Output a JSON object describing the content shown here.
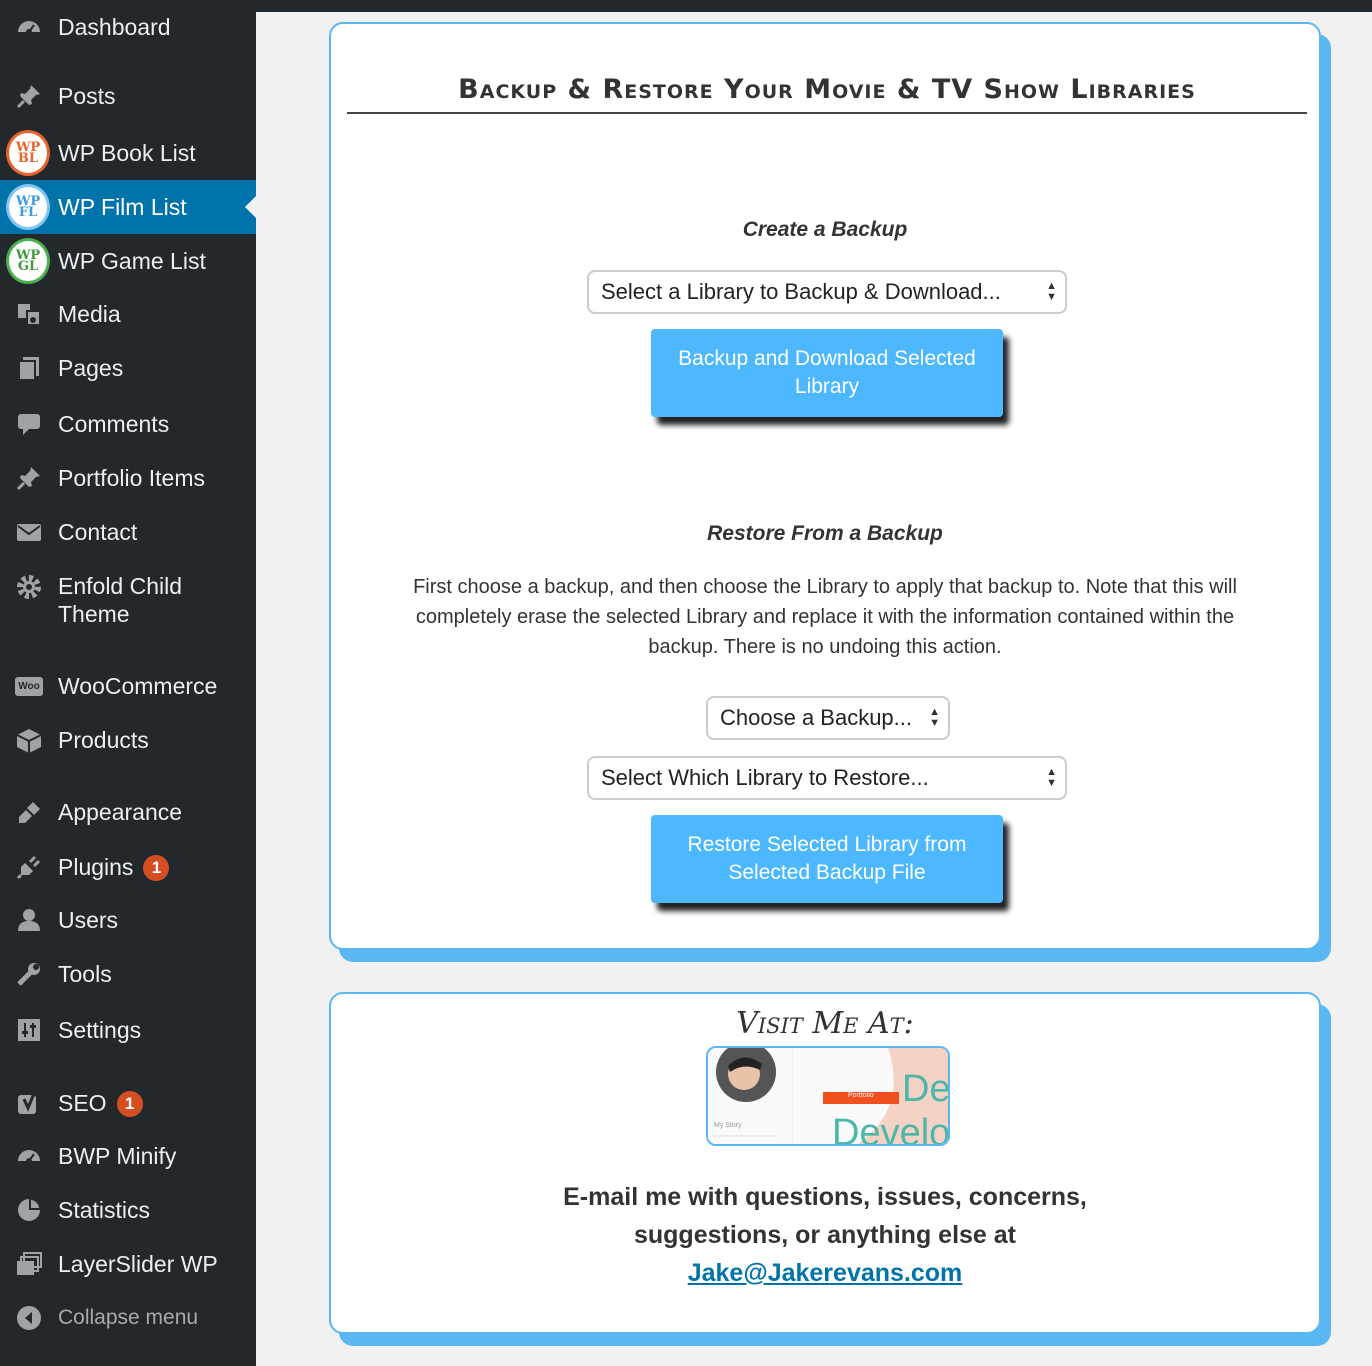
{
  "sidebar": {
    "items": [
      {
        "label": "Dashboard",
        "icon": "dashboard-icon"
      },
      {
        "label": "Posts",
        "icon": "pin-icon"
      },
      {
        "label": "WP Book List",
        "icon": "wpbl-logo-icon",
        "logo_top": "WP",
        "logo_bottom": "BL"
      },
      {
        "label": "WP Film List",
        "icon": "wpfl-logo-icon",
        "logo_top": "WP",
        "logo_bottom": "FL"
      },
      {
        "label": "WP Game List",
        "icon": "wpgl-logo-icon",
        "logo_top": "WP",
        "logo_bottom": "GL"
      },
      {
        "label": "Media",
        "icon": "media-icon"
      },
      {
        "label": "Pages",
        "icon": "pages-icon"
      },
      {
        "label": "Comments",
        "icon": "comment-icon"
      },
      {
        "label": "Portfolio Items",
        "icon": "pin-icon"
      },
      {
        "label": "Contact",
        "icon": "envelope-icon"
      },
      {
        "label": "Enfold Child",
        "label2": "Theme",
        "icon": "gear-icon"
      },
      {
        "label": "WooCommerce",
        "icon": "woo-icon",
        "icon_text": "Woo"
      },
      {
        "label": "Products",
        "icon": "box-icon"
      },
      {
        "label": "Appearance",
        "icon": "brush-icon"
      },
      {
        "label": "Plugins",
        "icon": "plug-icon",
        "badge": "1"
      },
      {
        "label": "Users",
        "icon": "user-icon"
      },
      {
        "label": "Tools",
        "icon": "wrench-icon"
      },
      {
        "label": "Settings",
        "icon": "settings-icon"
      },
      {
        "label": "SEO",
        "icon": "yoast-icon",
        "badge": "1"
      },
      {
        "label": "BWP Minify",
        "icon": "gauge-icon"
      },
      {
        "label": "Statistics",
        "icon": "pie-icon"
      },
      {
        "label": "LayerSlider WP",
        "icon": "layers-icon"
      }
    ],
    "collapse_label": "Collapse menu",
    "active_color": "#0073aa",
    "bg_color": "#23282d"
  },
  "main": {
    "title": "Backup & Restore Your Movie & TV Show Libraries",
    "create": {
      "heading": "Create a Backup",
      "select_value": "Select a Library to Backup & Download...",
      "button_line1": "Backup and Download Selected",
      "button_line2": "Library"
    },
    "restore": {
      "heading": "Restore From a Backup",
      "description_line1": "First choose a backup, and then choose the Library to apply that backup to. Note that this will",
      "description_line2": "completely erase the selected Library and replace it with the information contained within the",
      "description_line3": "backup. There is no undoing this action.",
      "backup_select_value": "Choose a Backup...",
      "library_select_value": "Select Which Library to Restore...",
      "button_line1": "Restore Selected Library from",
      "button_line2": "Selected Backup File"
    },
    "accent_color": "#5bb7f2",
    "button_color": "#4db8ff"
  },
  "footer_panel": {
    "visit_heading": "Visit Me At:",
    "thumbnail": {
      "badge_text": "Portfolio",
      "big_text_1": "De",
      "big_text_2": "Develo",
      "small_text": "My Story"
    },
    "email_line1": "E-mail me with questions, issues, concerns,",
    "email_line2": "suggestions, or anything else at",
    "email_link": "Jake@Jakerevans.com"
  }
}
